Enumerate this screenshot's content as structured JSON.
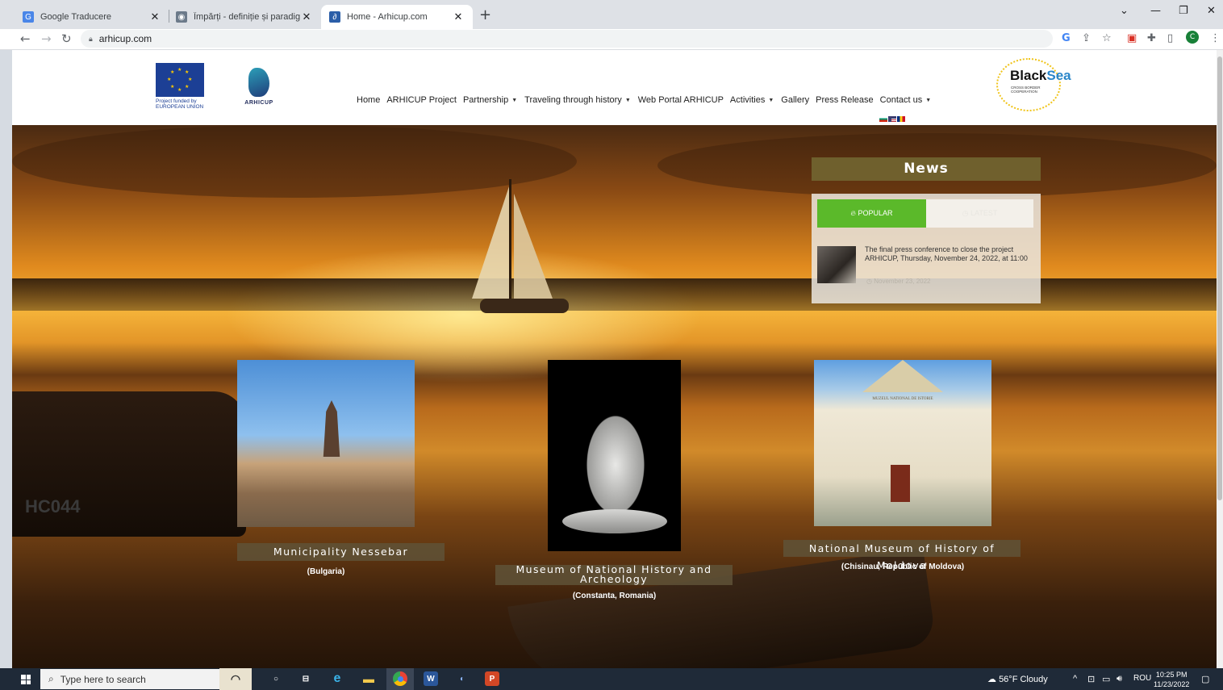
{
  "browser": {
    "tabs": [
      {
        "title": "Google Traducere",
        "active": false
      },
      {
        "title": "Împărți - definiție și paradigmă |",
        "active": false
      },
      {
        "title": "Home - Arhicup.com",
        "active": true
      }
    ],
    "url": "arhicup.com"
  },
  "site": {
    "eu_logo_text": "Project funded by EUROPEAN UNION",
    "arhicup_logo_text": "ARHICUP",
    "blacksea_logo_text": "Black Sea",
    "blacksea_logo_sub": "CROSS BORDER COOPERATION",
    "nav": [
      {
        "label": "Home",
        "dropdown": false
      },
      {
        "label": "ARHICUP Project",
        "dropdown": false
      },
      {
        "label": "Partnership",
        "dropdown": true
      },
      {
        "label": "Traveling through history",
        "dropdown": true
      },
      {
        "label": "Web Portal ARHICUP",
        "dropdown": false
      },
      {
        "label": "Activities",
        "dropdown": true
      },
      {
        "label": "Gallery",
        "dropdown": false
      },
      {
        "label": "Press Release",
        "dropdown": false
      },
      {
        "label": "Contact us",
        "dropdown": true
      }
    ],
    "news": {
      "title": "News",
      "tab_popular": "POPULAR",
      "tab_latest": "LATEST",
      "item_headline": "The final press conference to close the project ARHICUP, Thursday, November 24, 2022, at 11:00",
      "item_date": "November 23, 2022"
    },
    "cards": [
      {
        "title": "Municipality Nessebar",
        "subtitle": "(Bulgaria)"
      },
      {
        "title": "Museum of National History and Archeology",
        "subtitle": "(Constanta, Romania)"
      },
      {
        "title": "National Museum of History of Moldova",
        "subtitle": "(Chisinau, Republic of Moldova)"
      }
    ],
    "moldova_sign": "MUZEUL NATIONAL DE ISTORIE",
    "boat_text": "HC044"
  },
  "taskbar": {
    "search_placeholder": "Type here to search",
    "weather": "56°F  Cloudy",
    "language": "ROU",
    "time": "10:25 PM",
    "date": "11/23/2022"
  },
  "colors": {
    "popular_tab": "#5bb92a",
    "label_bg": "#5f5237",
    "news_title_bg": "#736932"
  }
}
